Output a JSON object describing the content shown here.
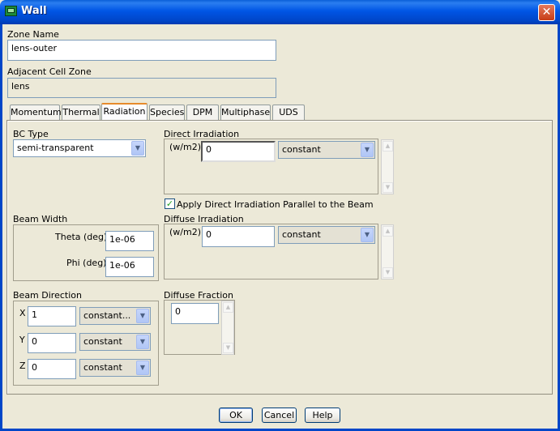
{
  "window": {
    "title": "Wall",
    "close_glyph": "✕"
  },
  "zone": {
    "name_label": "Zone Name",
    "name_value": "lens-outer",
    "adjacent_label": "Adjacent Cell Zone",
    "adjacent_value": "lens"
  },
  "tabs": [
    {
      "label": "Momentum",
      "active": false
    },
    {
      "label": "Thermal",
      "active": false
    },
    {
      "label": "Radiation",
      "active": true
    },
    {
      "label": "Species",
      "active": false
    },
    {
      "label": "DPM",
      "active": false
    },
    {
      "label": "Multiphase",
      "active": false
    },
    {
      "label": "UDS",
      "active": false
    }
  ],
  "radiation": {
    "bc_type": {
      "label": "BC Type",
      "value": "semi-transparent"
    },
    "direct_irradiation": {
      "label": "Direct Irradiation",
      "unit": "(w/m2)",
      "value": "0",
      "method": "constant"
    },
    "apply_parallel": {
      "label": "Apply Direct Irradiation Parallel to the Beam",
      "checked": true
    },
    "diffuse_irradiation": {
      "label": "Diffuse Irradiation",
      "unit": "(w/m2)",
      "value": "0",
      "method": "constant"
    },
    "beam_width": {
      "label": "Beam Width",
      "theta_label": "Theta (deg)",
      "theta_value": "1e-06",
      "phi_label": "Phi (deg)",
      "phi_value": "1e-06"
    },
    "beam_direction": {
      "label": "Beam Direction",
      "rows": [
        {
          "axis": "X",
          "value": "1",
          "method": "constant..."
        },
        {
          "axis": "Y",
          "value": "0",
          "method": "constant"
        },
        {
          "axis": "Z",
          "value": "0",
          "method": "constant"
        }
      ]
    },
    "diffuse_fraction": {
      "label": "Diffuse Fraction",
      "value": "0"
    }
  },
  "buttons": {
    "ok": "OK",
    "cancel": "Cancel",
    "help": "Help"
  },
  "icons": {
    "dropdown": "▼",
    "scroll_up": "▲",
    "scroll_down": "▼",
    "check": "✓"
  },
  "colors": {
    "titlebar": "#0055e5",
    "dialog_bg": "#ece9d8",
    "active_tab_accent": "#e68b2c",
    "close_button": "#c73c16"
  }
}
